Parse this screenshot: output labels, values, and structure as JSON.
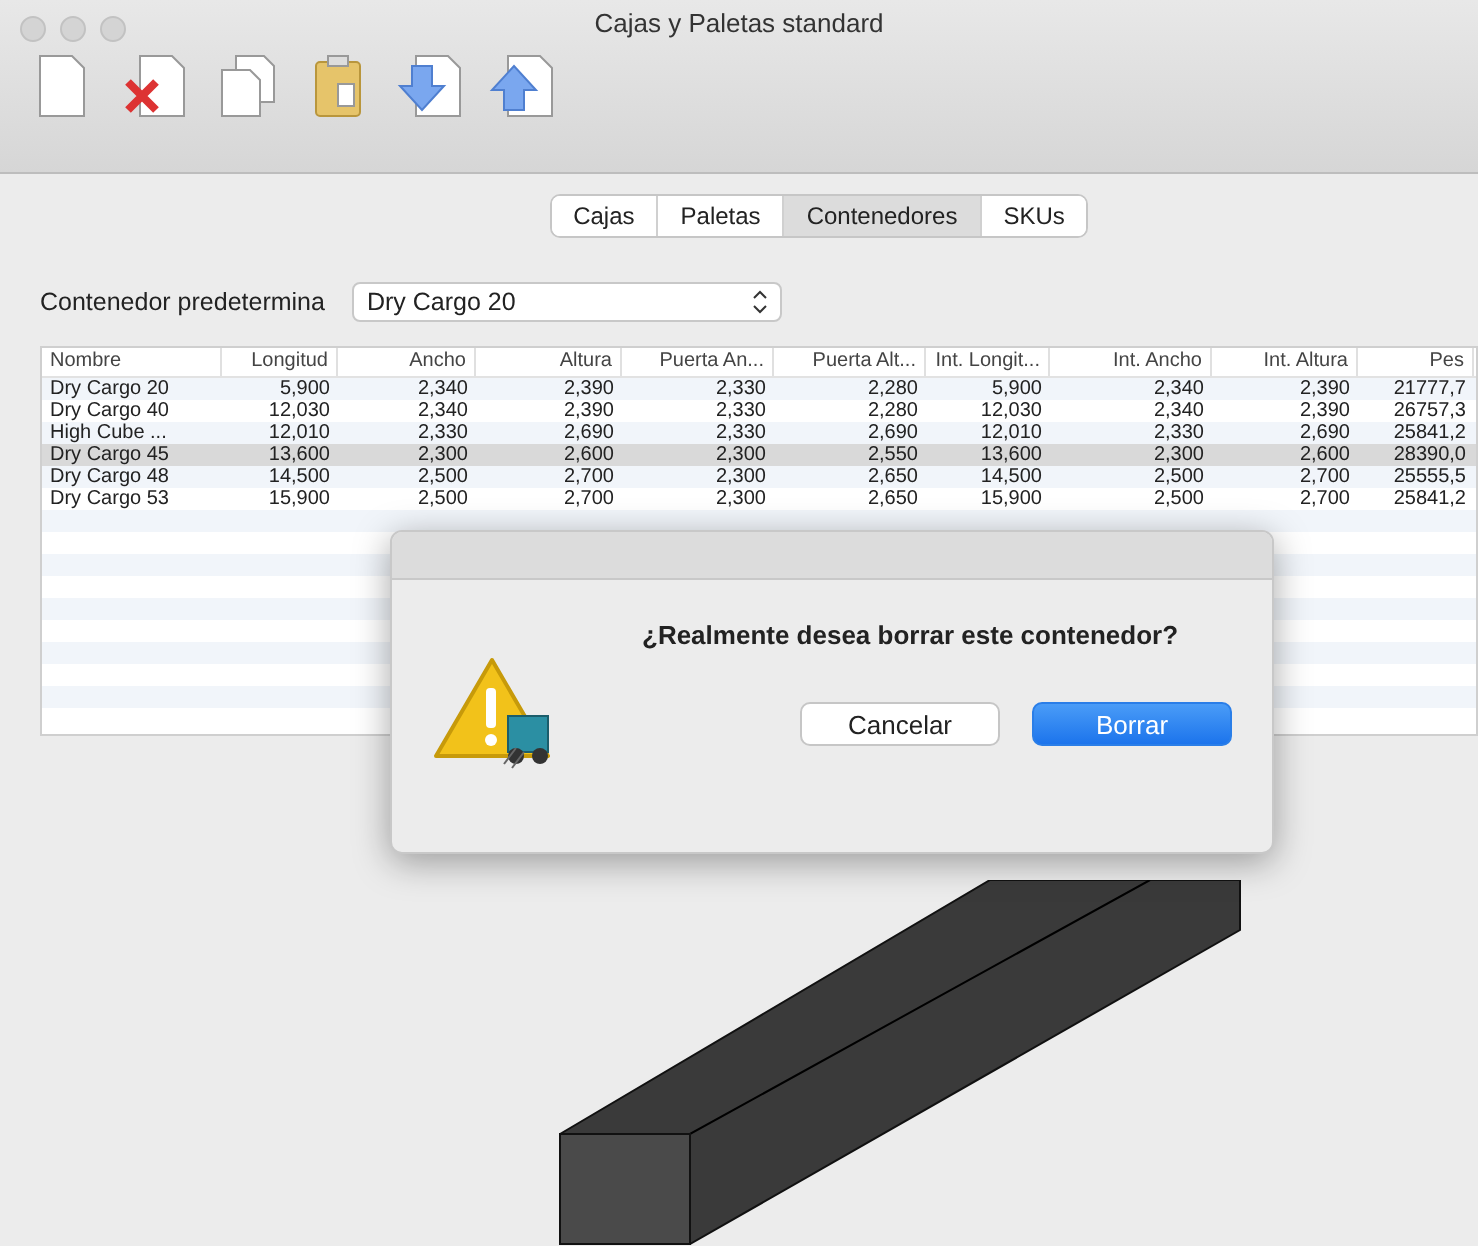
{
  "window": {
    "title": "Cajas y Paletas standard"
  },
  "tabs": [
    {
      "label": "Cajas",
      "selected": false
    },
    {
      "label": "Paletas",
      "selected": false
    },
    {
      "label": "Contenedores",
      "selected": true
    },
    {
      "label": "SKUs",
      "selected": false
    }
  ],
  "default_container": {
    "label": "Contenedor predetermina",
    "value": "Dry Cargo 20"
  },
  "table": {
    "columns": [
      "Nombre",
      "Longitud",
      "Ancho",
      "Altura",
      "Puerta An...",
      "Puerta Alt...",
      "Int. Longit...",
      "Int. Ancho",
      "Int. Altura",
      "Pes"
    ],
    "rows": [
      {
        "selected": false,
        "cells": [
          "Dry Cargo 20",
          "5,900",
          "2,340",
          "2,390",
          "2,330",
          "2,280",
          "5,900",
          "2,340",
          "2,390",
          "21777,7"
        ]
      },
      {
        "selected": false,
        "cells": [
          "Dry Cargo 40",
          "12,030",
          "2,340",
          "2,390",
          "2,330",
          "2,280",
          "12,030",
          "2,340",
          "2,390",
          "26757,3"
        ]
      },
      {
        "selected": false,
        "cells": [
          "High Cube ...",
          "12,010",
          "2,330",
          "2,690",
          "2,330",
          "2,690",
          "12,010",
          "2,330",
          "2,690",
          "25841,2"
        ]
      },
      {
        "selected": true,
        "cells": [
          "Dry Cargo 45",
          "13,600",
          "2,300",
          "2,600",
          "2,300",
          "2,550",
          "13,600",
          "2,300",
          "2,600",
          "28390,0"
        ]
      },
      {
        "selected": false,
        "cells": [
          "Dry Cargo 48",
          "14,500",
          "2,500",
          "2,700",
          "2,300",
          "2,650",
          "14,500",
          "2,500",
          "2,700",
          "25555,5"
        ]
      },
      {
        "selected": false,
        "cells": [
          "Dry Cargo 53",
          "15,900",
          "2,500",
          "2,700",
          "2,300",
          "2,650",
          "15,900",
          "2,500",
          "2,700",
          "25841,2"
        ]
      }
    ]
  },
  "dialog": {
    "message": "¿Realmente desea borrar este contenedor?",
    "buttons": [
      {
        "label": "Cancelar",
        "kind": "secondary"
      },
      {
        "label": "Borrar",
        "kind": "primary"
      }
    ]
  }
}
